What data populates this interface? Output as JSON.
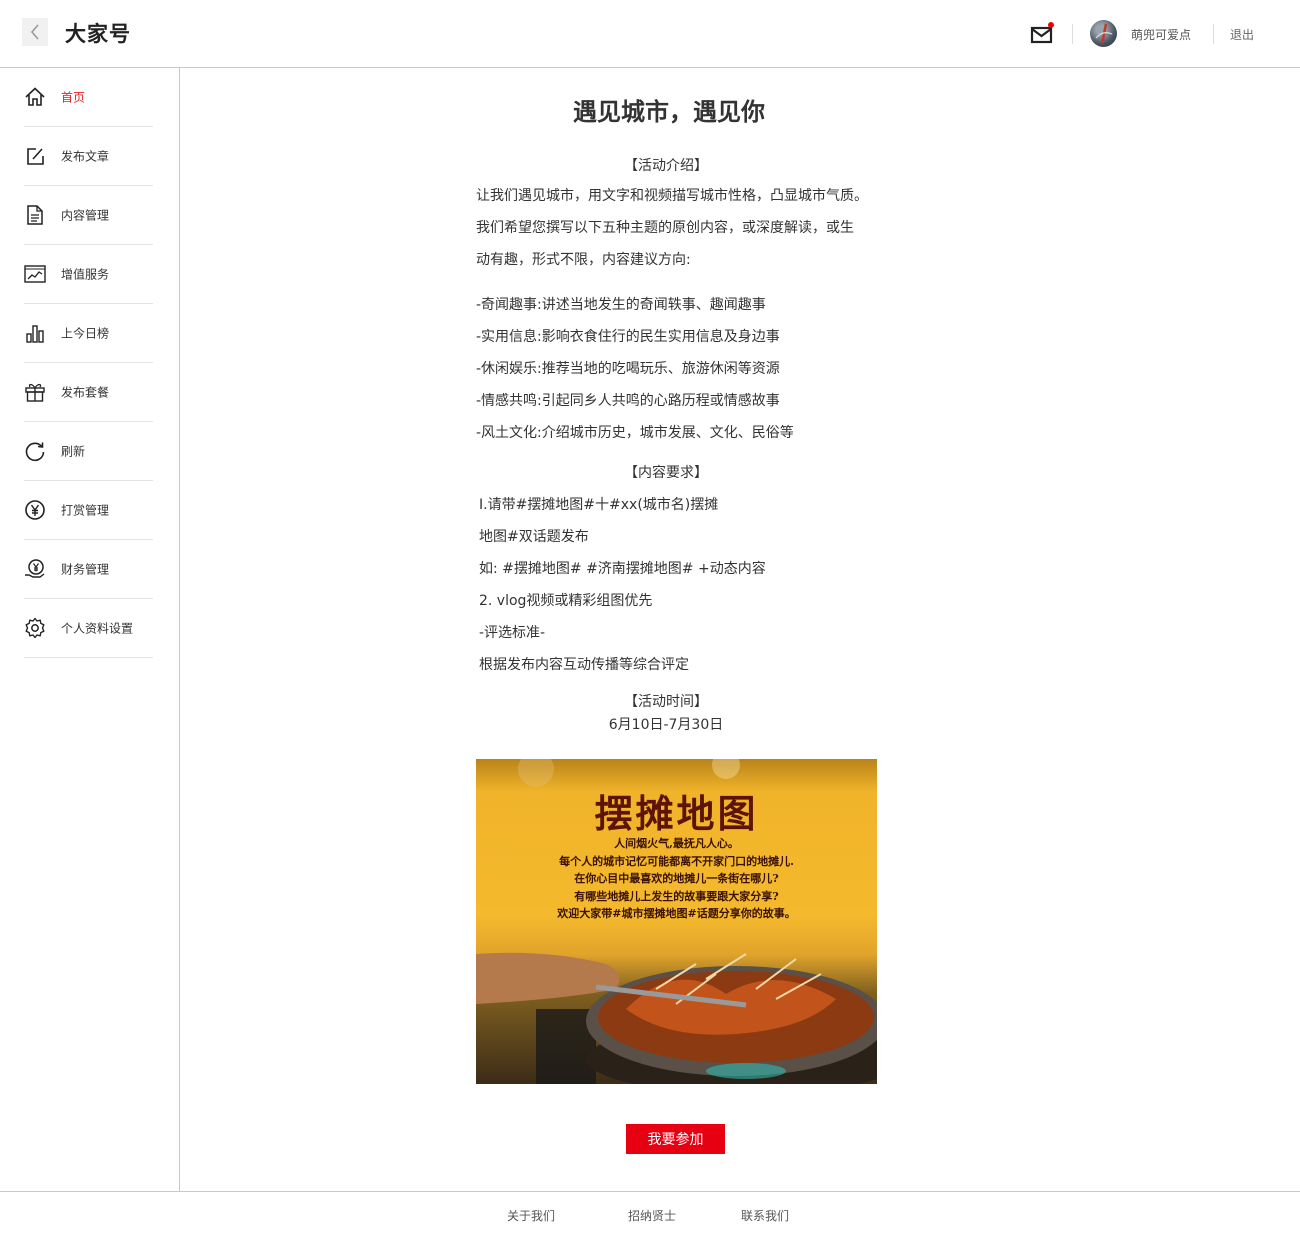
{
  "header": {
    "title": "大家号",
    "user_name": "萌兜可爱点",
    "logout_label": "退出"
  },
  "sidebar": {
    "items": [
      {
        "label": "首页",
        "icon": "home-icon",
        "active": true
      },
      {
        "label": "发布文章",
        "icon": "edit-icon"
      },
      {
        "label": "内容管理",
        "icon": "document-icon"
      },
      {
        "label": "增值服务",
        "icon": "trend-chart-icon"
      },
      {
        "label": "上今日榜",
        "icon": "bar-chart-icon"
      },
      {
        "label": "发布套餐",
        "icon": "gift-icon"
      },
      {
        "label": "刷新",
        "icon": "refresh-icon"
      },
      {
        "label": "打赏管理",
        "icon": "yen-coin-icon"
      },
      {
        "label": "财务管理",
        "icon": "yen-hand-icon"
      },
      {
        "label": "个人资料设置",
        "icon": "gear-icon"
      }
    ]
  },
  "main": {
    "title": "遇见城市，遇见你",
    "intro_heading": "【活动介绍】",
    "intro_lines": [
      "让我们遇见城市，用文字和视频描写城市性格，凸显城市气质。",
      "我们希望您撰写以下五种主题的原创内容，或深度解读，或生",
      "动有趣，形式不限，内容建议方向:"
    ],
    "topics": [
      "-奇闻趣事:讲述当地发生的奇闻轶事、趣闻趣事",
      "-实用信息:影响衣食住行的民生实用信息及身边事",
      "-休闲娱乐:推荐当地的吃喝玩乐、旅游休闲等资源",
      "-情感共鸣:引起同乡人共鸣的心路历程或情感故事",
      "-风土文化:介绍城市历史，城市发展、文化、民俗等"
    ],
    "requirements_heading": "【内容要求】",
    "requirements": [
      "I.请带#摆摊地图#十#xx(城市名)摆摊",
      "地图#双话题发布",
      "如: #摆摊地图# #济南摆摊地图# +动态内容",
      "2. vlog视频或精彩组图优先",
      "-评选标准-",
      "根据发布内容互动传播等综合评定"
    ],
    "time_heading": "【活动时间】",
    "time_value": "6月10日-7月30日",
    "poster": {
      "title": "摆摊地图",
      "lines": [
        "人间烟火气,最抚凡人心。",
        "每个人的城市记忆可能都离不开家门口的地摊儿.",
        "在你心目中最喜欢的地摊儿一条街在哪儿?",
        "有哪些地摊儿上发生的故事要跟大家分享?",
        "欢迎大家带#城市摆摊地图#话题分享你的故事。"
      ]
    },
    "join_label": "我要参加"
  },
  "footer": {
    "links": [
      "关于我们",
      "招纳贤士",
      "联系我们"
    ]
  },
  "colors": {
    "accent": "#e60012",
    "active_nav": "#e02424",
    "border": "#b9cfcf"
  }
}
